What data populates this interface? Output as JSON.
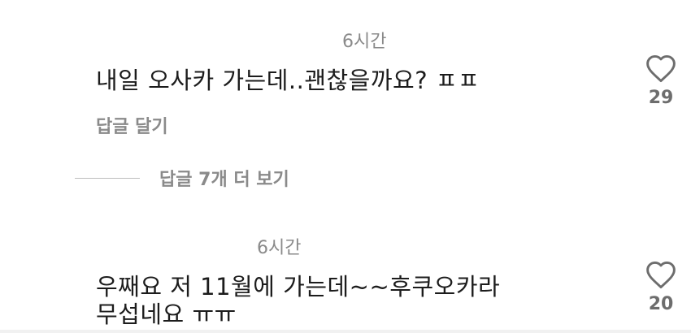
{
  "comments": [
    {
      "time": "6시간",
      "text": "내일 오사카 가는데..괜찮을까요? ㅍㅍ",
      "reply_label": "답글 달기",
      "like_count": "29"
    },
    {
      "time": "6시간",
      "text_line1": "우째요 저 11월에 가는데~~후쿠오카라",
      "text_line2": "무섭네요 ㅠㅠ",
      "like_count": "20"
    }
  ],
  "view_more": {
    "label": "답글 7개 더 보기"
  },
  "icons": {
    "like": "heart-outline-icon"
  },
  "colors": {
    "text": "#1c1c1c",
    "muted": "#8a8a8a",
    "icon": "#6d6d6d"
  }
}
